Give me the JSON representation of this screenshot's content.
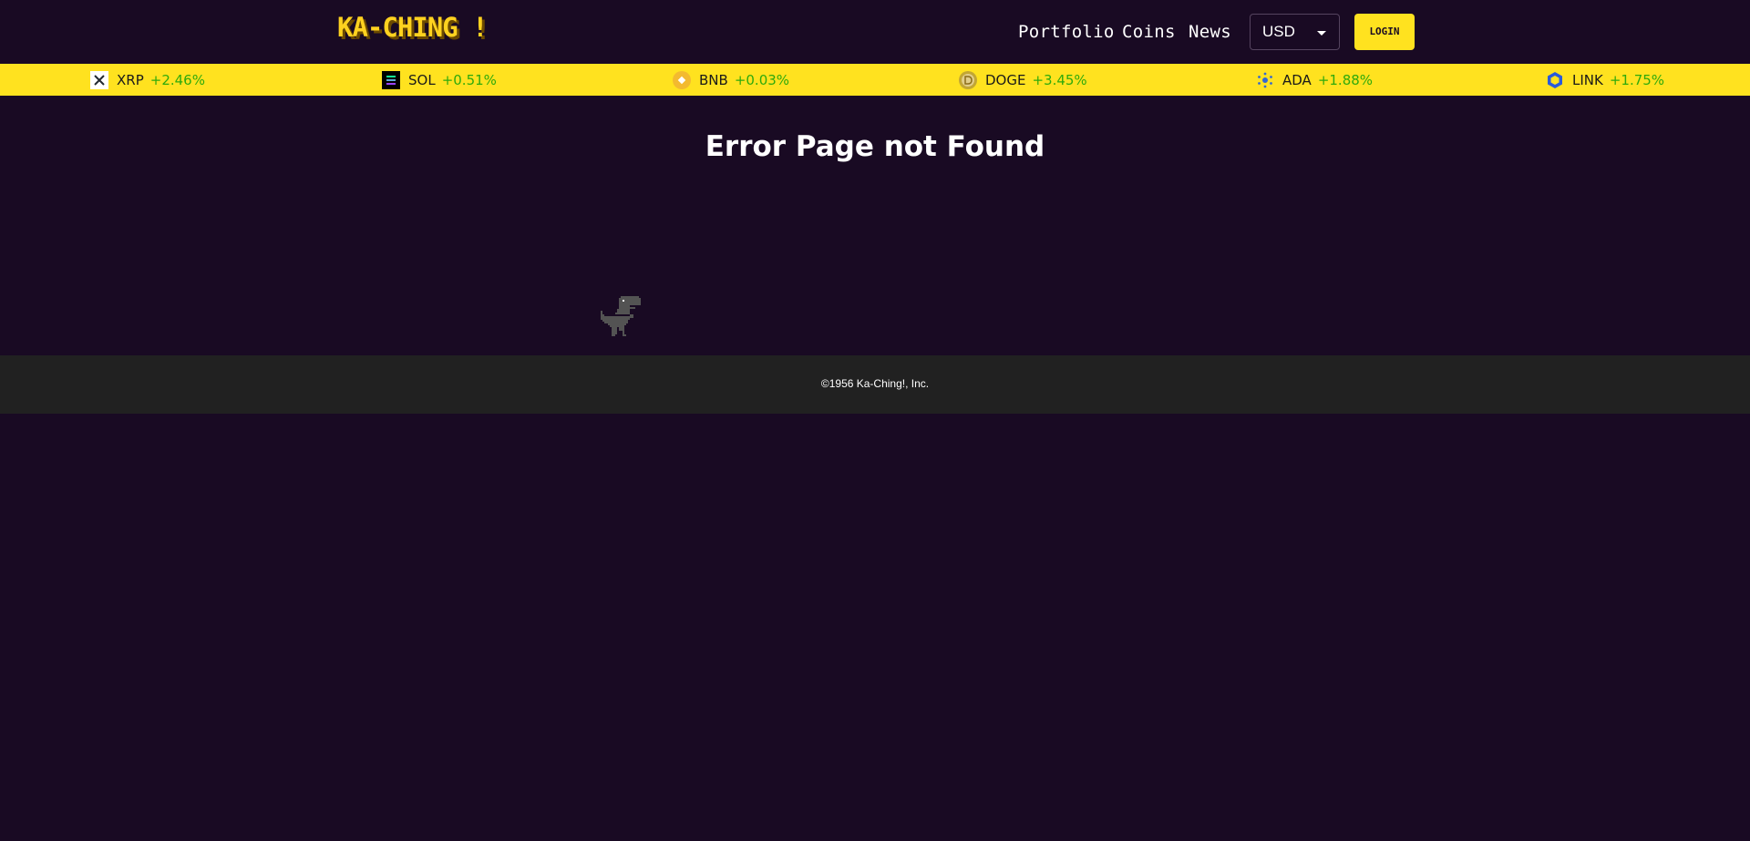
{
  "brand": {
    "logo_text": "KA-CHING !"
  },
  "nav": {
    "links": [
      {
        "label": "Portfolio"
      },
      {
        "label": "Coins"
      },
      {
        "label": "News"
      }
    ],
    "currency": {
      "selected": "USD"
    },
    "login_label": "LOGIN"
  },
  "ticker": [
    {
      "symbol": "XRP",
      "change": "+2.46%",
      "icon": "xrp-icon"
    },
    {
      "symbol": "SOL",
      "change": "+0.51%",
      "icon": "solana-icon"
    },
    {
      "symbol": "BNB",
      "change": "+0.03%",
      "icon": "bnb-icon"
    },
    {
      "symbol": "DOGE",
      "change": "+3.45%",
      "icon": "dogecoin-icon"
    },
    {
      "symbol": "ADA",
      "change": "+1.88%",
      "icon": "cardano-icon"
    },
    {
      "symbol": "LINK",
      "change": "+1.75%",
      "icon": "chainlink-icon"
    }
  ],
  "main": {
    "title": "Error Page not Found"
  },
  "footer": {
    "copyright": "©1956 Ka-Ching!, Inc."
  },
  "colors": {
    "background": "#190a23",
    "accent": "#ffe21f",
    "positive": "#2eaa0c",
    "footer": "#212121"
  }
}
